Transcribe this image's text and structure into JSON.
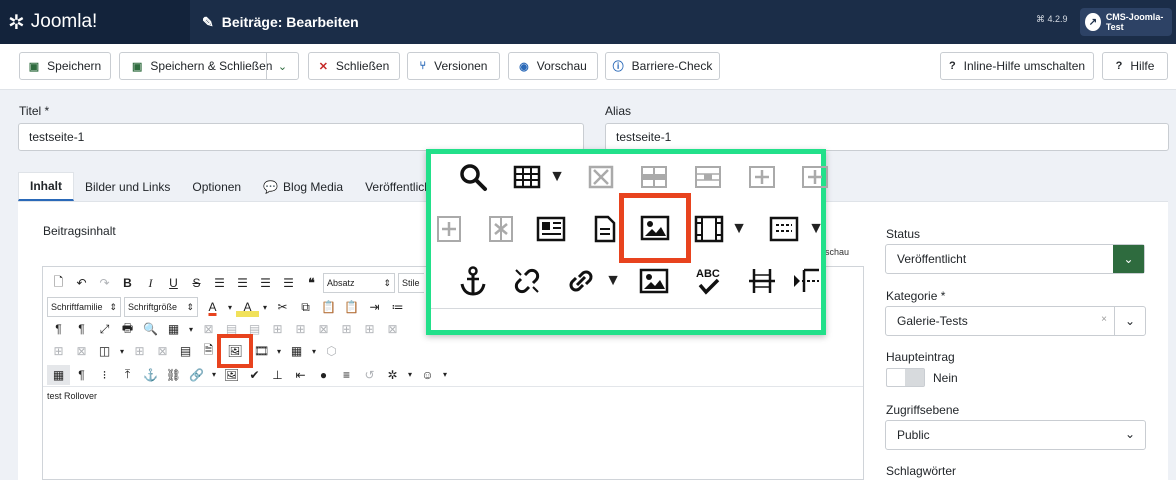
{
  "header": {
    "logo_text": "Joomla!",
    "title": "Beiträge: Bearbeiten",
    "version": "4.2.9",
    "site_button": "CMS-Joomla-Test",
    "color": "#1b2d48"
  },
  "toolbar": {
    "save": "Speichern",
    "save_close": "Speichern & Schließen",
    "close": "Schließen",
    "versions": "Versionen",
    "preview": "Vorschau",
    "accessibility": "Barriere-Check",
    "inline_help": "Inline-Hilfe umschalten",
    "help": "Hilfe"
  },
  "form": {
    "title_label": "Titel *",
    "title_value": "testseite-1",
    "alias_label": "Alias",
    "alias_value": "testseite-1"
  },
  "tabs": [
    "Inhalt",
    "Bilder und Links",
    "Optionen",
    "Blog Media",
    "Veröffentlichung"
  ],
  "editor": {
    "label": "Beitragsinhalt",
    "format_select": "Absatz",
    "style_select": "Stile",
    "font_family_select": "Schriftfamilie",
    "font_size_select": "Schriftgröße",
    "toggle_partial": "rschau",
    "content": "test Rollover"
  },
  "sidebar": {
    "status_label": "Status",
    "status_value": "Veröffentlicht",
    "category_label": "Kategorie *",
    "category_value": "Galerie-Tests",
    "featured_label": "Haupteintrag",
    "featured_value": "Nein",
    "access_label": "Zugriffsebene",
    "access_value": "Public",
    "tags_label": "Schlagwörter"
  },
  "accent_colors": {
    "callout_border": "#22e08a",
    "highlight": "#e8431e",
    "status_dropdown": "#2e6b3e"
  }
}
